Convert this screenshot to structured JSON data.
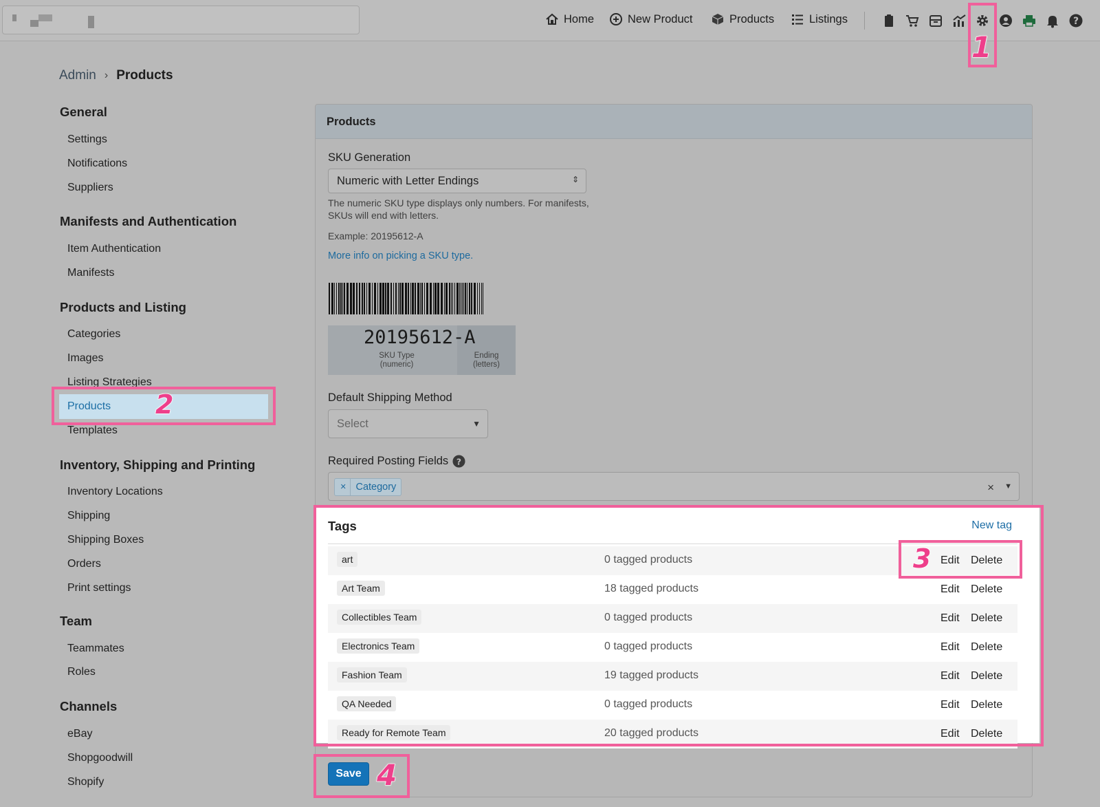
{
  "topbar": {
    "nav": [
      {
        "label": "Home",
        "icon": "home-icon"
      },
      {
        "label": "New Product",
        "icon": "plus-circle-icon"
      },
      {
        "label": "Products",
        "icon": "box-icon"
      },
      {
        "label": "Listings",
        "icon": "list-icon"
      }
    ],
    "icons": [
      "clipboard-icon",
      "cart-icon",
      "archive-icon",
      "chart-icon",
      "gear-icon",
      "user-icon",
      "printer-icon",
      "bell-icon",
      "help-icon"
    ]
  },
  "annotations": {
    "n1": "1",
    "n2": "2",
    "n3": "3",
    "n4": "4",
    "color": "#f0609b"
  },
  "breadcrumb": {
    "parent": "Admin",
    "separator": "›",
    "current": "Products"
  },
  "sidebar": {
    "sections": [
      {
        "title": "General",
        "items": [
          "Settings",
          "Notifications",
          "Suppliers"
        ]
      },
      {
        "title": "Manifests and Authentication",
        "items": [
          "Item Authentication",
          "Manifests"
        ]
      },
      {
        "title": "Products and Listing",
        "items": [
          "Categories",
          "Images",
          "Listing Strategies",
          "Products",
          "Templates"
        ]
      },
      {
        "title": "Inventory, Shipping and Printing",
        "items": [
          "Inventory Locations",
          "Shipping",
          "Shipping Boxes",
          "Orders",
          "Print settings"
        ]
      },
      {
        "title": "Team",
        "items": [
          "Teammates",
          "Roles"
        ]
      },
      {
        "title": "Channels",
        "items": [
          "eBay",
          "Shopgoodwill",
          "Shopify"
        ]
      }
    ],
    "active_item": "Products"
  },
  "panel": {
    "title": "Products",
    "sku_label": "SKU Generation",
    "sku_value": "Numeric with Letter Endings",
    "sku_help_1": "The numeric SKU type displays only numbers. For manifests,",
    "sku_help_2": "SKUs will end with letters.",
    "sku_example": "Example: 20195612-A",
    "sku_link": "More info on picking a SKU type.",
    "sku_sample": "20195612-A",
    "sku_type_cap_1": "SKU Type",
    "sku_type_cap_2": "(numeric)",
    "sku_end_cap_1": "Ending",
    "sku_end_cap_2": "(letters)",
    "shipping_label": "Default Shipping Method",
    "shipping_placeholder": "Select",
    "required_label": "Required Posting Fields",
    "required_chip": "Category",
    "chip_remove": "×",
    "clear_symbol": "×"
  },
  "tags": {
    "title": "Tags",
    "new_tag": "New tag",
    "edit_label": "Edit",
    "delete_label": "Delete",
    "rows": [
      {
        "name": "art",
        "count": "0 tagged products"
      },
      {
        "name": "Art Team",
        "count": "18 tagged products"
      },
      {
        "name": "Collectibles Team",
        "count": "0 tagged products"
      },
      {
        "name": "Electronics Team",
        "count": "0 tagged products"
      },
      {
        "name": "Fashion Team",
        "count": "19 tagged products"
      },
      {
        "name": "QA Needed",
        "count": "0 tagged products"
      },
      {
        "name": "Ready for Remote Team",
        "count": "20 tagged products"
      }
    ]
  },
  "save_label": "Save"
}
